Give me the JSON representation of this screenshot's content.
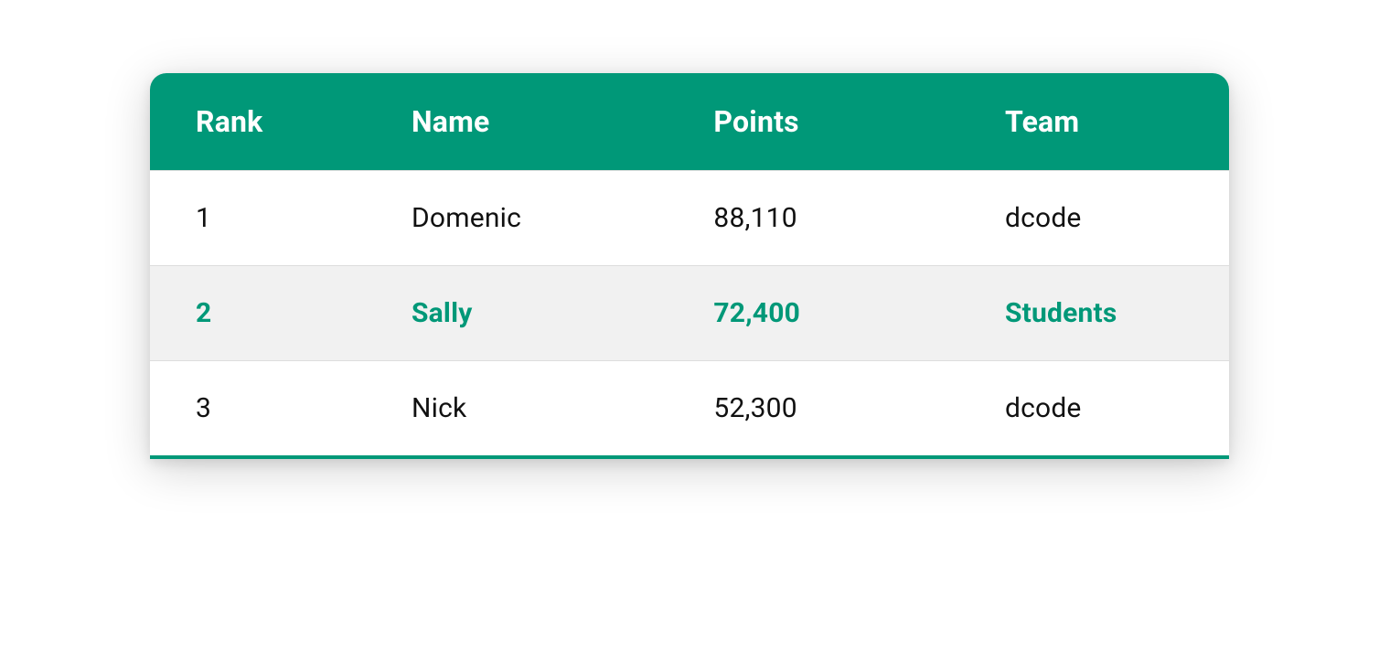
{
  "headers": {
    "rank": "Rank",
    "name": "Name",
    "points": "Points",
    "team": "Team"
  },
  "rows": [
    {
      "rank": "1",
      "name": "Domenic",
      "points": "88,110",
      "team": "dcode",
      "active": false
    },
    {
      "rank": "2",
      "name": "Sally",
      "points": "72,400",
      "team": "Students",
      "active": true
    },
    {
      "rank": "3",
      "name": "Nick",
      "points": "52,300",
      "team": "dcode",
      "active": false
    }
  ],
  "colors": {
    "accent": "#009878",
    "active_row_bg": "#f1f1f1"
  }
}
